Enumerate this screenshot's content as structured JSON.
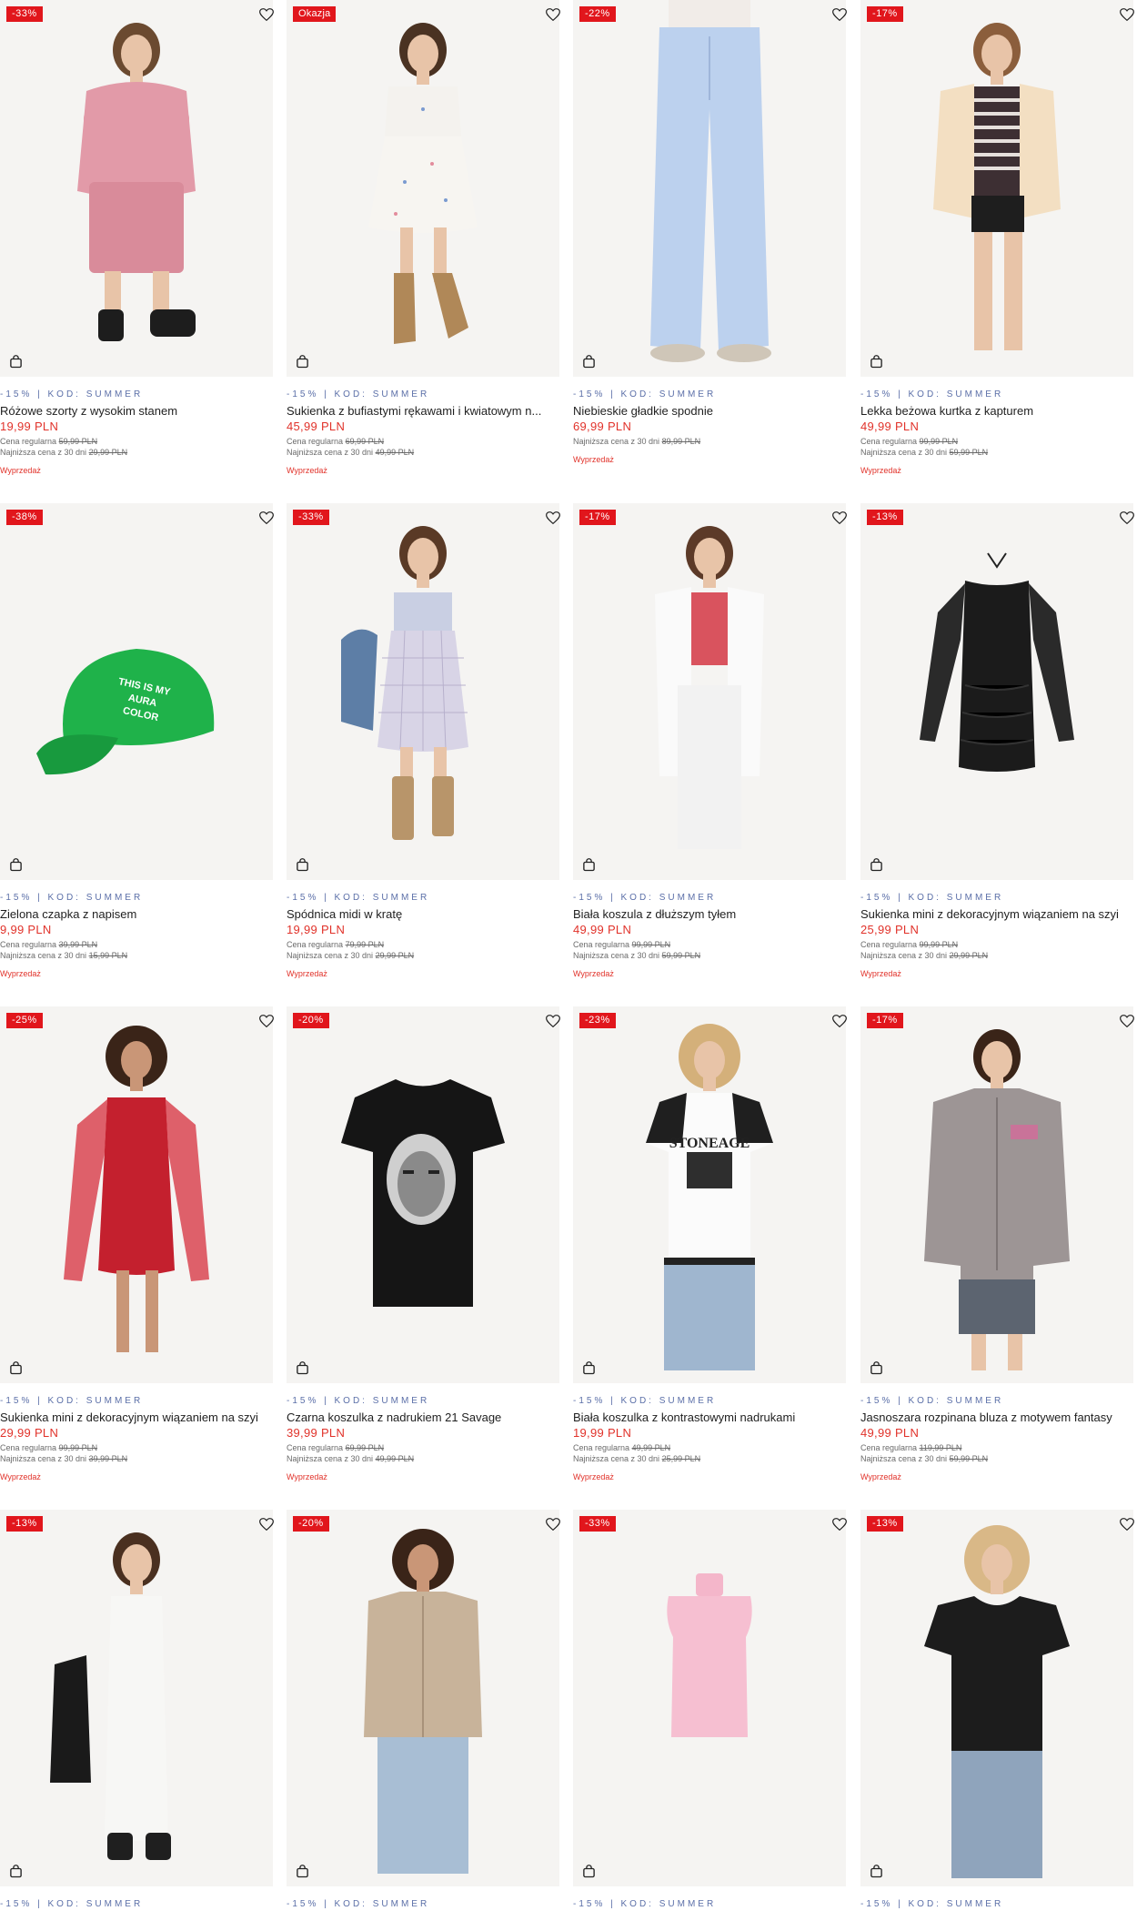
{
  "colors": {
    "badge": "#e1161c",
    "price": "#e1322a",
    "promo": "#5b6fa8",
    "sale": "#e1322a"
  },
  "icons": {
    "wishlist": "heart-icon",
    "cart": "shopping-bag-icon"
  },
  "products": [
    {
      "badge": "-33%",
      "promo": "-15% | KOD: SUMMER",
      "name": "Różowe szorty z wysokim stanem",
      "price": "19,99 PLN",
      "regular_label": "Cena regularna",
      "regular_price": "59,99 PLN",
      "lowest_label": "Najniższa cena z 30 dni",
      "lowest_price": "29,99 PLN",
      "sale": "Wyprzedaż",
      "art": "pink"
    },
    {
      "badge": "Okazja",
      "promo": "-15% | KOD: SUMMER",
      "name": "Sukienka z bufiastymi rękawami i kwiatowym n...",
      "price": "45,99 PLN",
      "regular_label": "Cena regularna",
      "regular_price": "69,99 PLN",
      "lowest_label": "Najniższa cena z 30 dni",
      "lowest_price": "49,99 PLN",
      "sale": "Wyprzedaż",
      "art": "dress-white"
    },
    {
      "badge": "-22%",
      "promo": "-15% | KOD: SUMMER",
      "name": "Niebieskie gładkie spodnie",
      "price": "69,99 PLN",
      "regular_label": "",
      "regular_price": "",
      "lowest_label": "Najniższa cena z 30 dni",
      "lowest_price": "89,99 PLN",
      "sale": "Wyprzedaż",
      "art": "pants-blue"
    },
    {
      "badge": "-17%",
      "promo": "-15% | KOD: SUMMER",
      "name": "Lekka beżowa kurtka z kapturem",
      "price": "49,99 PLN",
      "regular_label": "Cena regularna",
      "regular_price": "99,99 PLN",
      "lowest_label": "Najniższa cena z 30 dni",
      "lowest_price": "59,99 PLN",
      "sale": "Wyprzedaż",
      "art": "jacket-beige"
    },
    {
      "badge": "-38%",
      "promo": "-15% | KOD: SUMMER",
      "name": "Zielona czapka z napisem",
      "price": "9,99 PLN",
      "regular_label": "Cena regularna",
      "regular_price": "39,99 PLN",
      "lowest_label": "Najniższa cena z 30 dni",
      "lowest_price": "15,99 PLN",
      "sale": "Wyprzedaż",
      "art": "cap-green",
      "cap_text": [
        "THIS IS MY",
        "AURA",
        "COLOR"
      ]
    },
    {
      "badge": "-33%",
      "promo": "-15% | KOD: SUMMER",
      "name": "Spódnica midi w kratę",
      "price": "19,99 PLN",
      "regular_label": "Cena regularna",
      "regular_price": "79,99 PLN",
      "lowest_label": "Najniższa cena z 30 dni",
      "lowest_price": "29,99 PLN",
      "sale": "Wyprzedaż",
      "art": "skirt-check"
    },
    {
      "badge": "-17%",
      "promo": "-15% | KOD: SUMMER",
      "name": "Biała koszula z dłuższym tyłem",
      "price": "49,99 PLN",
      "regular_label": "Cena regularna",
      "regular_price": "99,99 PLN",
      "lowest_label": "Najniższa cena z 30 dni",
      "lowest_price": "59,99 PLN",
      "sale": "Wyprzedaż",
      "art": "shirt-white"
    },
    {
      "badge": "-13%",
      "promo": "-15% | KOD: SUMMER",
      "name": "Sukienka mini z dekoracyjnym wiązaniem na szyi",
      "price": "25,99 PLN",
      "regular_label": "Cena regularna",
      "regular_price": "99,99 PLN",
      "lowest_label": "Najniższa cena z 30 dni",
      "lowest_price": "29,99 PLN",
      "sale": "Wyprzedaż",
      "art": "dress-black"
    },
    {
      "badge": "-25%",
      "promo": "-15% | KOD: SUMMER",
      "name": "Sukienka mini z dekoracyjnym wiązaniem na szyi",
      "price": "29,99 PLN",
      "regular_label": "Cena regularna",
      "regular_price": "99,99 PLN",
      "lowest_label": "Najniższa cena z 30 dni",
      "lowest_price": "39,99 PLN",
      "sale": "Wyprzedaż",
      "art": "dress-red"
    },
    {
      "badge": "-20%",
      "promo": "-15% | KOD: SUMMER",
      "name": "Czarna koszulka z nadrukiem 21 Savage",
      "price": "39,99 PLN",
      "regular_label": "Cena regularna",
      "regular_price": "69,99 PLN",
      "lowest_label": "Najniższa cena z 30 dni",
      "lowest_price": "49,99 PLN",
      "sale": "Wyprzedaż",
      "art": "tee-black"
    },
    {
      "badge": "-23%",
      "promo": "-15% | KOD: SUMMER",
      "name": "Biała koszulka z kontrastowymi nadrukami",
      "price": "19,99 PLN",
      "regular_label": "Cena regularna",
      "regular_price": "49,99 PLN",
      "lowest_label": "Najniższa cena z 30 dni",
      "lowest_price": "25,99 PLN",
      "sale": "Wyprzedaż",
      "art": "tee-white",
      "tee_text": "STONEAGE"
    },
    {
      "badge": "-17%",
      "promo": "-15% | KOD: SUMMER",
      "name": "Jasnoszara rozpinana bluza z motywem fantasy",
      "price": "49,99 PLN",
      "regular_label": "Cena regularna",
      "regular_price": "119,99 PLN",
      "lowest_label": "Najniższa cena z 30 dni",
      "lowest_price": "59,99 PLN",
      "sale": "Wyprzedaż",
      "art": "hoodie-grey"
    },
    {
      "badge": "-13%",
      "promo": "-15% | KOD: SUMMER",
      "name": "",
      "price": "",
      "regular_label": "",
      "regular_price": "",
      "lowest_label": "",
      "lowest_price": "",
      "sale": "",
      "art": "dress-long-white"
    },
    {
      "badge": "-20%",
      "promo": "-15% | KOD: SUMMER",
      "name": "",
      "price": "",
      "regular_label": "",
      "regular_price": "",
      "lowest_label": "",
      "lowest_price": "",
      "sale": "",
      "art": "cardigan-beige"
    },
    {
      "badge": "-33%",
      "promo": "-15% | KOD: SUMMER",
      "name": "",
      "price": "",
      "regular_label": "",
      "regular_price": "",
      "lowest_label": "",
      "lowest_price": "",
      "sale": "",
      "art": "top-pink"
    },
    {
      "badge": "-13%",
      "promo": "-15% | KOD: SUMMER",
      "name": "",
      "price": "",
      "regular_label": "",
      "regular_price": "",
      "lowest_label": "",
      "lowest_price": "",
      "sale": "",
      "art": "tee-black-women"
    }
  ]
}
